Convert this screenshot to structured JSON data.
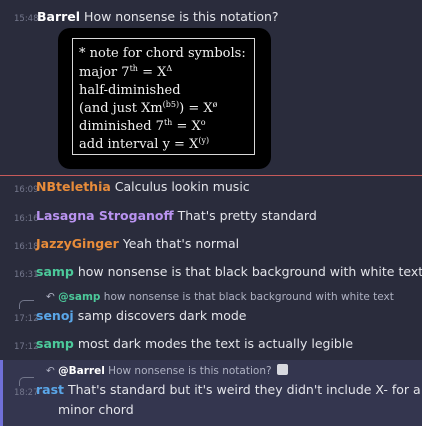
{
  "messages": [
    {
      "time": "15:48",
      "user": "Barrel",
      "user_color": "#ffffff",
      "text": "How nonsense is this notation?"
    },
    {
      "time": "16:09",
      "user": "NBtelethia",
      "user_color": "#e88c3a",
      "text": "Calculus lookin music"
    },
    {
      "time": "16:16",
      "user": "Lasagna Stroganoff",
      "user_color": "#b993f0",
      "text": "That's pretty standard"
    },
    {
      "time": "16:18",
      "user": "JazzyGinger",
      "user_color": "#e88c3a",
      "text": "Yeah that's normal"
    },
    {
      "time": "16:31",
      "user": "samp",
      "user_color": "#4cc99a",
      "text": "how nonsense is that black background with white text"
    },
    {
      "time": "17:12",
      "user": "senoj",
      "user_color": "#5aa6e8",
      "text": "samp discovers dark mode",
      "reply": {
        "user": "@samp",
        "user_color": "#4cc99a",
        "text": "how nonsense is that black background with white text"
      }
    },
    {
      "time": "17:12",
      "user": "samp",
      "user_color": "#4cc99a",
      "text": "most dark modes the text is actually legible"
    },
    {
      "time": "18:27",
      "user": "rast",
      "user_color": "#5aa6e8",
      "text_line1": "That's standard but it's weird they didn't include X- for a",
      "text_line2": "minor chord",
      "reply": {
        "user": "@Barrel",
        "user_color": "#ffffff",
        "text": "How nonsense is this notation?"
      }
    }
  ],
  "image": {
    "lines": [
      {
        "main": "* note for chord symbols:"
      },
      {
        "main": "major 7",
        "sup": "th",
        "after": " = X",
        "sup2": "Δ"
      },
      {
        "main": "half-diminished"
      },
      {
        "main": "(and just Xm",
        "sup": "(b5)",
        "after": ")  = X",
        "sup2": "ø"
      },
      {
        "main": "diminished 7",
        "sup": "th",
        "after": " = X",
        "sup2": "o"
      },
      {
        "main": "add interval y = X",
        "sup": "(y)"
      }
    ]
  },
  "icons": {
    "reply": "reply-arrow-icon",
    "attachment": "image-attachment-icon"
  },
  "colors": {
    "background": "#2a2c3c",
    "highlight": "#34364f",
    "divider": "#c65a5a"
  }
}
